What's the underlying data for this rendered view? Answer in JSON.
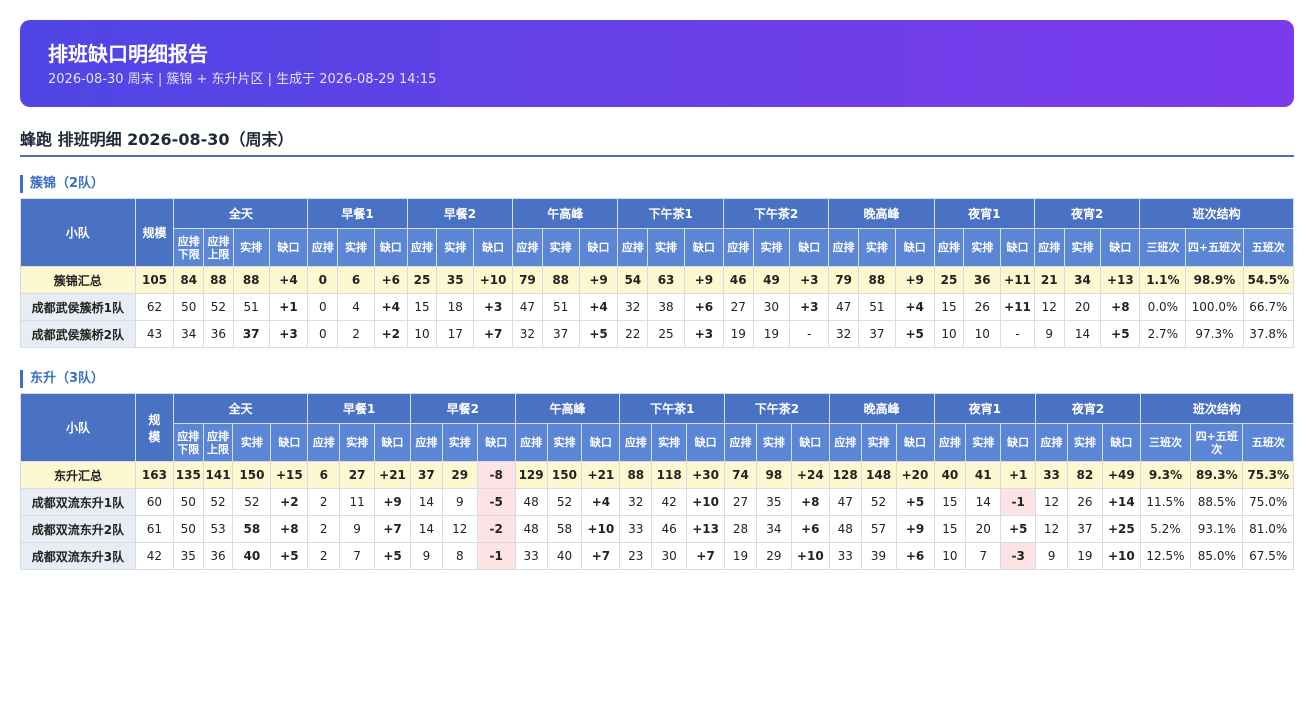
{
  "header": {
    "title": "排班缺口明细报告",
    "subtitle": "2026-08-30 周末 | 簇锦 + 东升片区 | 生成于 2026-08-29 14:15"
  },
  "section_title": "蜂跑 排班明细 2026-08-30（周末）",
  "columns": {
    "team": "小队",
    "size": "规模",
    "size_wrapped": "规\n模",
    "periods": [
      "全天",
      "早餐1",
      "早餐2",
      "午高峰",
      "下午茶1",
      "下午茶2",
      "晚高峰",
      "夜宵1",
      "夜宵2"
    ],
    "structure": "班次结构",
    "allday_sub": [
      "应排下限",
      "应排上限",
      "实排",
      "缺口"
    ],
    "period_sub": [
      "应排",
      "实排",
      "缺口"
    ],
    "struct_sub_1": [
      "三班次",
      "四+五班次",
      "五班次"
    ],
    "struct_sub_2": [
      "三班次",
      "四+五班次",
      "五班次"
    ]
  },
  "groups": [
    {
      "title": "簇锦（2队）",
      "rows": [
        {
          "name": "簇锦汇总",
          "sum": true,
          "cells": [
            "105",
            "84",
            "88",
            "88",
            "+4",
            "0",
            "6",
            "+6",
            "25",
            "35",
            "+10",
            "79",
            "88",
            "+9",
            "54",
            "63",
            "+9",
            "46",
            "49",
            "+3",
            "79",
            "88",
            "+9",
            "25",
            "36",
            "+11",
            "21",
            "34",
            "+13",
            "1.1%",
            "98.9%",
            "54.5%"
          ]
        },
        {
          "name": "成都武侯簇桥1队",
          "sum": false,
          "cells": [
            "62",
            "50",
            "52",
            "51",
            "+1",
            "0",
            "4",
            "+4",
            "15",
            "18",
            "+3",
            "47",
            "51",
            "+4",
            "32",
            "38",
            "+6",
            "27",
            "30",
            "+3",
            "47",
            "51",
            "+4",
            "15",
            "26",
            "+11",
            "12",
            "20",
            "+8",
            "0.0%",
            "100.0%",
            "66.7%"
          ]
        },
        {
          "name": "成都武侯簇桥2队",
          "sum": false,
          "cells": [
            "43",
            "34",
            "36",
            "37",
            "+3",
            "0",
            "2",
            "+2",
            "10",
            "17",
            "+7",
            "32",
            "37",
            "+5",
            "22",
            "25",
            "+3",
            "19",
            "19",
            "-",
            "32",
            "37",
            "+5",
            "10",
            "10",
            "-",
            "9",
            "14",
            "+5",
            "2.7%",
            "97.3%",
            "37.8%"
          ]
        }
      ]
    },
    {
      "title": "东升（3队）",
      "rows": [
        {
          "name": "东升汇总",
          "sum": true,
          "cells": [
            "163",
            "135",
            "141",
            "150",
            "+15",
            "6",
            "27",
            "+21",
            "37",
            "29",
            "-8",
            "129",
            "150",
            "+21",
            "88",
            "118",
            "+30",
            "74",
            "98",
            "+24",
            "128",
            "148",
            "+20",
            "40",
            "41",
            "+1",
            "33",
            "82",
            "+49",
            "9.3%",
            "89.3%",
            "75.3%"
          ]
        },
        {
          "name": "成都双流东升1队",
          "sum": false,
          "cells": [
            "60",
            "50",
            "52",
            "52",
            "+2",
            "2",
            "11",
            "+9",
            "14",
            "9",
            "-5",
            "48",
            "52",
            "+4",
            "32",
            "42",
            "+10",
            "27",
            "35",
            "+8",
            "47",
            "52",
            "+5",
            "15",
            "14",
            "-1",
            "12",
            "26",
            "+14",
            "11.5%",
            "88.5%",
            "75.0%"
          ]
        },
        {
          "name": "成都双流东升2队",
          "sum": false,
          "cells": [
            "61",
            "50",
            "53",
            "58",
            "+8",
            "2",
            "9",
            "+7",
            "14",
            "12",
            "-2",
            "48",
            "58",
            "+10",
            "33",
            "46",
            "+13",
            "28",
            "34",
            "+6",
            "48",
            "57",
            "+9",
            "15",
            "20",
            "+5",
            "12",
            "37",
            "+25",
            "5.2%",
            "93.1%",
            "81.0%"
          ]
        },
        {
          "name": "成都双流东升3队",
          "sum": false,
          "cells": [
            "42",
            "35",
            "36",
            "40",
            "+5",
            "2",
            "7",
            "+5",
            "9",
            "8",
            "-1",
            "33",
            "40",
            "+7",
            "23",
            "30",
            "+7",
            "19",
            "29",
            "+10",
            "33",
            "39",
            "+6",
            "10",
            "7",
            "-3",
            "9",
            "19",
            "+10",
            "12.5%",
            "85.0%",
            "67.5%"
          ]
        }
      ]
    }
  ],
  "colors": {
    "banner_start": "#4f46e5",
    "banner_end": "#7c3aed",
    "header_blue": "#4a72c4",
    "positive": "#2f8f3a",
    "negative": "#d23c3c",
    "summary_bg": "#fdf8d0"
  }
}
